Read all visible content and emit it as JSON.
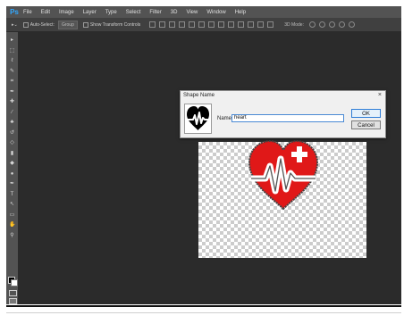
{
  "app": {
    "logo": "Ps"
  },
  "menu": [
    "File",
    "Edit",
    "Image",
    "Layer",
    "Type",
    "Select",
    "Filter",
    "3D",
    "View",
    "Window",
    "Help"
  ],
  "options": {
    "auto_select": "Auto-Select:",
    "auto_select_value": "Group",
    "show_transform": "Show Transform Controls",
    "mode_3d": "3D Mode:"
  },
  "tools": [
    "move-tool",
    "marquee-tool",
    "lasso-tool",
    "quick-select-tool",
    "crop-tool",
    "eyedropper-tool",
    "spot-heal-tool",
    "brush-tool",
    "clone-stamp-tool",
    "history-brush-tool",
    "eraser-tool",
    "gradient-tool",
    "blur-tool",
    "dodge-tool",
    "pen-tool",
    "type-tool",
    "path-select-tool",
    "shape-tool",
    "hand-tool",
    "zoom-tool"
  ],
  "tool_glyphs": [
    "▸",
    "⬚",
    "ℓ",
    "✎",
    "⌗",
    "✒",
    "✚",
    "∕",
    "♣",
    "↺",
    "◇",
    "▮",
    "◆",
    "●",
    "✒",
    "T",
    "↖",
    "▭",
    "✋",
    "⚲"
  ],
  "dialog": {
    "title": "Shape Name",
    "close": "×",
    "name_label": "Name:",
    "name_value": "heart",
    "ok": "OK",
    "cancel": "Cancel"
  },
  "colors": {
    "heart_red": "#e01818",
    "ps_blue": "#31a8ff"
  }
}
